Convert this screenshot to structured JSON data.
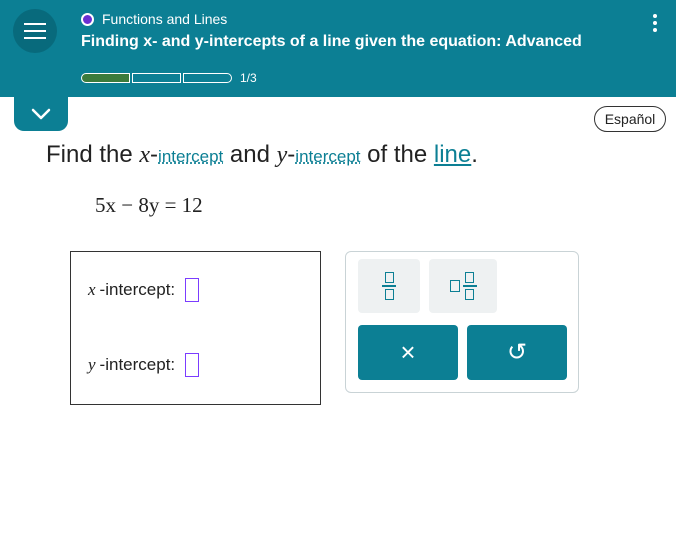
{
  "header": {
    "topic": "Functions and Lines",
    "title": "Finding x- and y-intercepts of a line given the equation: Advanced",
    "progress_text": "1/3",
    "progress_filled_segments": 1,
    "progress_total_segments": 3
  },
  "language_button": "Español",
  "prompt": {
    "find": "Find the ",
    "x_var": "x",
    "dash1": "-",
    "intercept_link1": "intercept",
    "and": " and ",
    "y_var": "y",
    "dash2": "-",
    "intercept_link2": "intercept",
    "of_the": " of the ",
    "line_link": "line",
    "period": "."
  },
  "equation": "5x − 8y = 12",
  "answers": {
    "x_var": "x",
    "x_label": "-intercept:",
    "x_value": "",
    "y_var": "y",
    "y_label": "-intercept:",
    "y_value": ""
  },
  "keypad": {
    "clear_symbol": "×",
    "undo_symbol": "↺"
  },
  "colors": {
    "brand": "#0c7f94",
    "progress_fill": "#3c7b3c",
    "topic_dot": "#6a2fd1",
    "input_border": "#7b3cff"
  }
}
